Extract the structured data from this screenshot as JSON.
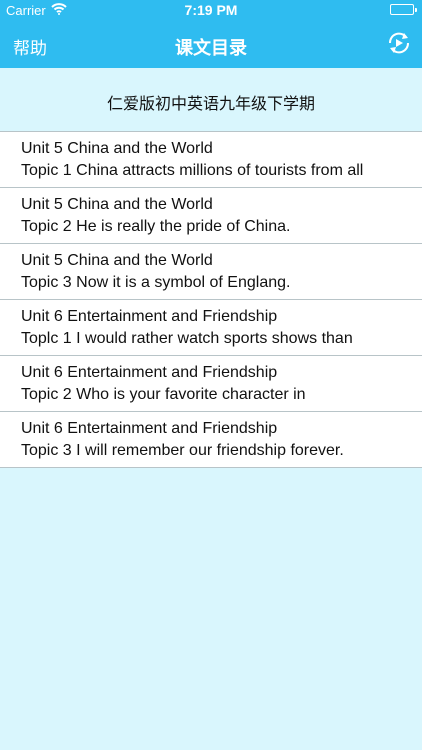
{
  "status_bar": {
    "carrier": "Carrier",
    "time": "7:19 PM"
  },
  "nav": {
    "help_label": "帮助",
    "title": "课文目录"
  },
  "list": {
    "header": "仁爱版初中英语九年级下学期",
    "items": [
      {
        "unit": "Unit 5 China and the World",
        "topic": "Topic 1 China attracts millions of tourists from all"
      },
      {
        "unit": "Unit 5 China and the World",
        "topic": "Topic 2 He is really the pride of China."
      },
      {
        "unit": "Unit 5 China and the World",
        "topic": "Topic 3 Now it is a symbol of Englang."
      },
      {
        "unit": "Unit 6 Entertainment and Friendship",
        "topic": "Toplc 1 I would rather watch sports shows than"
      },
      {
        "unit": "Unit 6 Entertainment and Friendship",
        "topic": "Topic 2 Who is your favorite character in"
      },
      {
        "unit": "Unit 6 Entertainment and Friendship",
        "topic": "Topic 3 I will remember our friendship forever."
      }
    ]
  },
  "colors": {
    "nav_bar": "#2fbcf0",
    "background": "#d9f6fd"
  },
  "icons": {
    "wifi": "wifi-icon",
    "battery": "battery-icon",
    "play": "play-refresh-icon"
  }
}
